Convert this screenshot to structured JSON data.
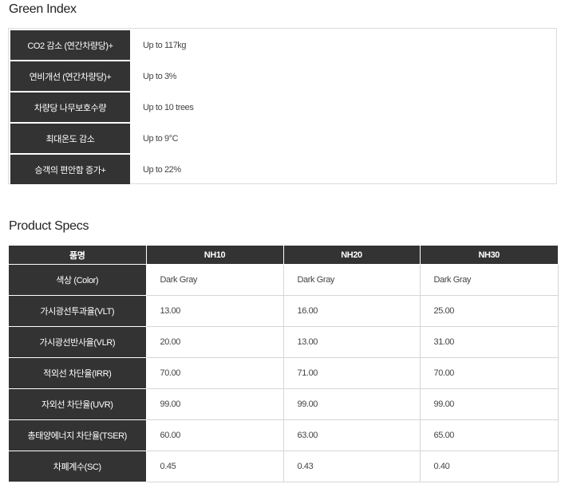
{
  "green_index": {
    "title": "Green Index",
    "rows": [
      {
        "label": "CO2 감소 (연간차량당)+",
        "value": "Up to 117kg"
      },
      {
        "label": "연비개선 (연간차량당)+",
        "value": "Up to 3%"
      },
      {
        "label": "차량당 나무보호수량",
        "value": "Up to 10 trees"
      },
      {
        "label": "최대온도 감소",
        "value": "Up to 9°C"
      },
      {
        "label": "승객의 편안함 증가+",
        "value": "Up to 22%"
      }
    ]
  },
  "product_specs": {
    "title": "Product Specs",
    "columns": [
      "품명",
      "NH10",
      "NH20",
      "NH30"
    ],
    "rows": [
      {
        "label": "색상 (Color)",
        "values": [
          "Dark Gray",
          "Dark Gray",
          "Dark Gray"
        ]
      },
      {
        "label": "가시광선투과율(VLT)",
        "values": [
          "13.00",
          "16.00",
          "25.00"
        ]
      },
      {
        "label": "가시광선반사율(VLR)",
        "values": [
          "20.00",
          "13.00",
          "31.00"
        ]
      },
      {
        "label": "적외선 차단율(IRR)",
        "values": [
          "70.00",
          "71.00",
          "70.00"
        ]
      },
      {
        "label": "자외선 차단율(UVR)",
        "values": [
          "99.00",
          "99.00",
          "99.00"
        ]
      },
      {
        "label": "총태양에너지 차단율(TSER)",
        "values": [
          "60.00",
          "63.00",
          "65.00"
        ]
      },
      {
        "label": "차폐계수(SC)",
        "values": [
          "0.45",
          "0.43",
          "0.40"
        ]
      }
    ]
  }
}
